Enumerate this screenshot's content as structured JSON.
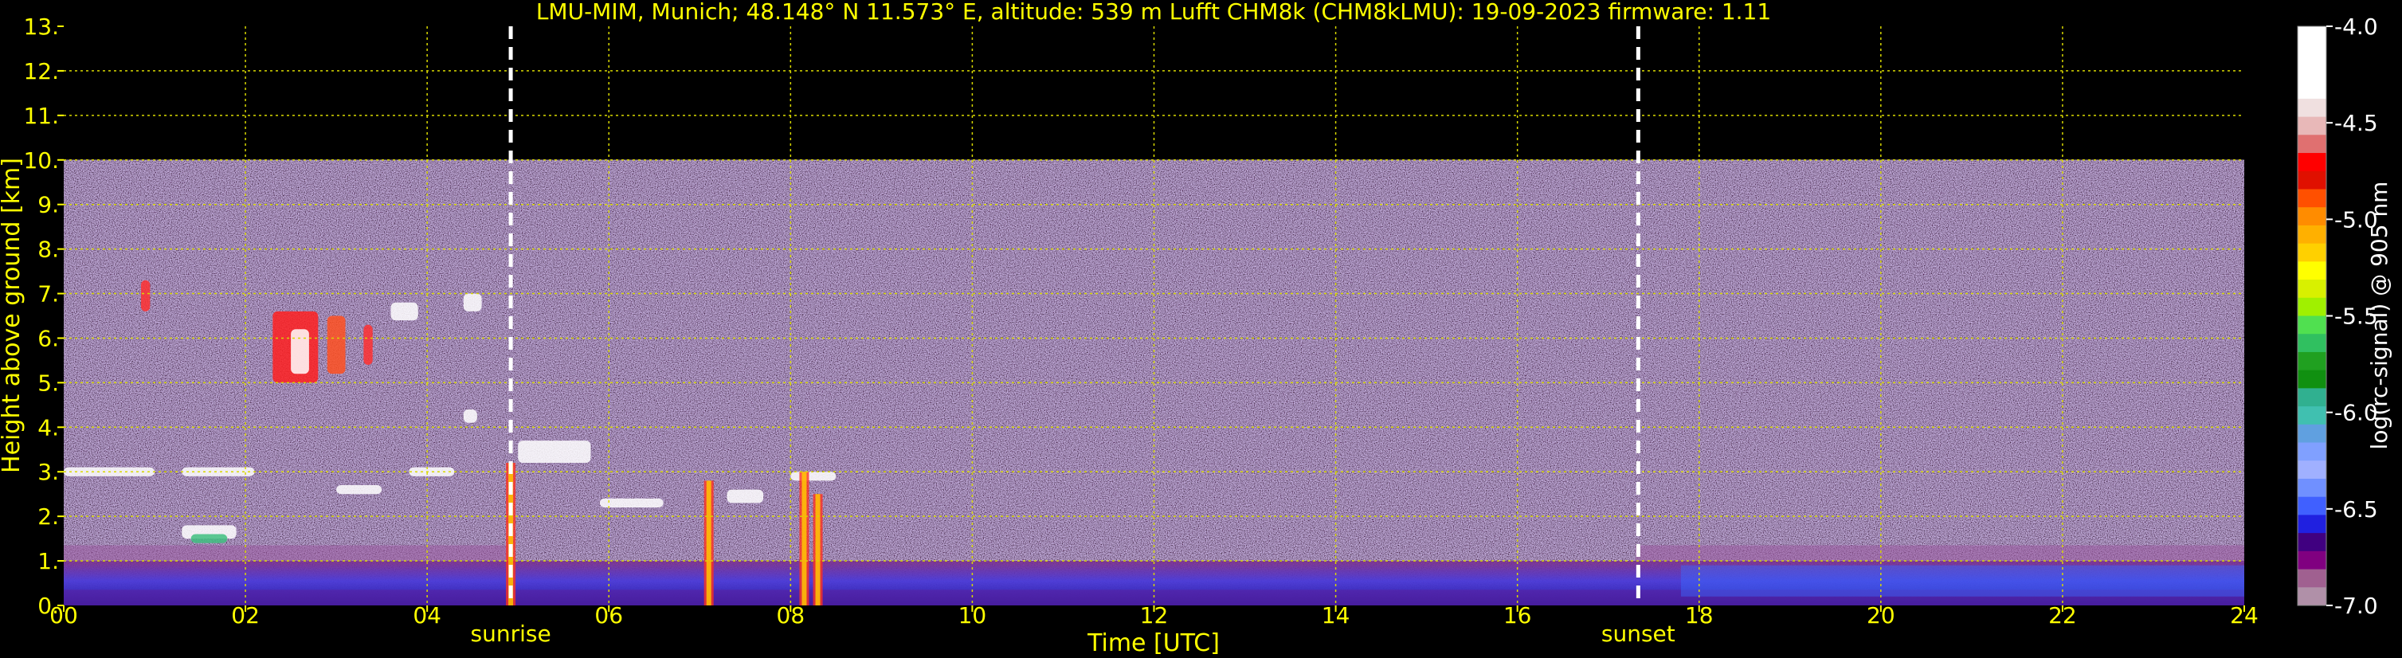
{
  "title": "LMU-MIM, Munich; 48.148° N 11.573° E, altitude: 539 m    Lufft CHM8k (CHM8kLMU): 19-09-2023    firmware: 1.11",
  "colors": {
    "background": "#000000",
    "text": "#ffff00",
    "grid": "#d8d800",
    "marker": "#ffffff"
  },
  "chart_data": {
    "type": "heatmap",
    "title": "LMU-MIM, Munich; 48.148° N 11.573° E, altitude: 539 m    Lufft CHM8k (CHM8kLMU): 19-09-2023    firmware: 1.11",
    "xlabel": "Time [UTC]",
    "ylabel": "Height above ground [km]",
    "xlim": [
      0,
      24
    ],
    "ylim": [
      0,
      13
    ],
    "grid": true,
    "x_ticks": [
      "00",
      "02",
      "04",
      "06",
      "08",
      "10",
      "12",
      "14",
      "16",
      "18",
      "20",
      "22",
      "24"
    ],
    "y_ticks": [
      "0.",
      "1.",
      "2.",
      "3.",
      "4.",
      "5.",
      "6.",
      "7.",
      "8.",
      "9.",
      "10.",
      "11.",
      "12.",
      "13."
    ],
    "signal_top_km": 10,
    "markers": [
      {
        "label": "sunrise",
        "time": 4.92
      },
      {
        "label": "sunset",
        "time": 17.33
      }
    ],
    "colorbar": {
      "label": "log(rc-signal) @ 905 nm",
      "range": [
        -7.0,
        -4.0
      ],
      "ticks": [
        "-4.0",
        "-4.5",
        "-5.0",
        "-5.5",
        "-6.0",
        "-6.5",
        "-7.0"
      ],
      "colors": [
        "#ffffff",
        "#ffffff",
        "#ffffff",
        "#ffffff",
        "#f0e0e0",
        "#e8b8b8",
        "#e07070",
        "#ff0000",
        "#e01000",
        "#ff5000",
        "#ff8c00",
        "#ffb000",
        "#ffd000",
        "#ffff00",
        "#d8f000",
        "#a0f000",
        "#50e050",
        "#30c060",
        "#20a020",
        "#109010",
        "#30b090",
        "#40c0b0",
        "#60a0e0",
        "#80a0ff",
        "#a0b0ff",
        "#7090ff",
        "#4060ff",
        "#2020e0",
        "#400080",
        "#800080",
        "#a06090",
        "#b090a8"
      ]
    }
  }
}
